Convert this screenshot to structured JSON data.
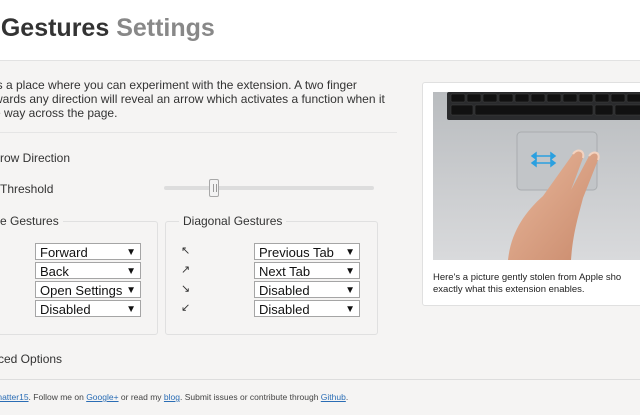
{
  "header": {
    "title_main": "e Gestures",
    "title_sub": "Settings"
  },
  "intro": {
    "line1": "is a place where you can experiment with the extension. A two finger",
    "line2": "wards any direction will reveal an arrow which activates a function when it",
    "line3": "e way across the page."
  },
  "options": {
    "arrow_direction_label": "rrow Direction",
    "threshold_label": "Threshold",
    "threshold_value": 0.24,
    "advanced_label": "ced Options"
  },
  "straight_gestures": {
    "title": "e Gestures",
    "rows": [
      {
        "value": "Forward"
      },
      {
        "value": "Back"
      },
      {
        "value": "Open Settings"
      },
      {
        "value": "Disabled"
      }
    ]
  },
  "diagonal_gestures": {
    "title": "Diagonal Gestures",
    "rows": [
      {
        "arrow": "↖",
        "value": "Previous Tab"
      },
      {
        "arrow": "↗",
        "value": "Next Tab"
      },
      {
        "arrow": "↘",
        "value": "Disabled"
      },
      {
        "arrow": "↙",
        "value": "Disabled"
      }
    ]
  },
  "image_card": {
    "caption": "Here's a picture gently stolen from Apple sho exactly what this extension enables.",
    "icon": "trackpad-two-finger-swipe-photo"
  },
  "footer": {
    "author_link": "matter15",
    "text1": ". Follow me on ",
    "google_link": "Google+",
    "text2": " or read my ",
    "blog_link": "blog",
    "text3": ". Submit issues or contribute through ",
    "github_link": "Github",
    "text4": "."
  },
  "colors": {
    "link": "#2a6db5",
    "title_sub": "#888888",
    "header_bg": "#ffffff",
    "page_bg": "#f5f4f3"
  }
}
